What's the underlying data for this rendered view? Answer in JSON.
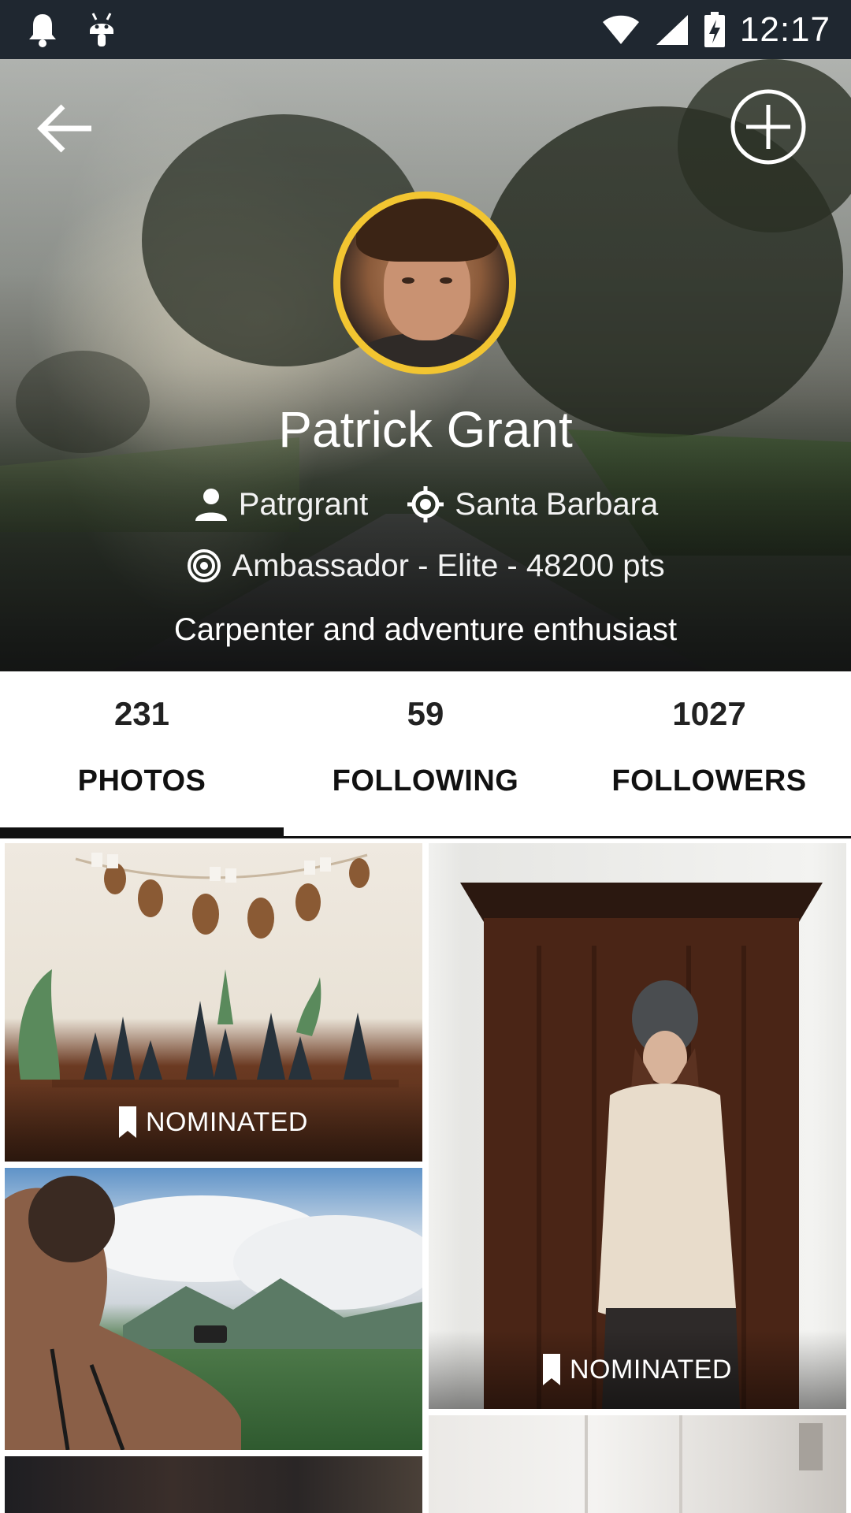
{
  "status_bar": {
    "time": "12:17",
    "icons": [
      "bell-icon",
      "android-icon",
      "wifi-icon",
      "cell-signal-icon",
      "battery-icon"
    ]
  },
  "header": {
    "back_icon": "arrow-back-icon",
    "add_icon": "add-circle-icon"
  },
  "profile": {
    "name": "Patrick Grant",
    "username": "Patrgrant",
    "location": "Santa Barbara",
    "rank": "Ambassador - Elite - 48200 pts",
    "bio": "Carpenter and adventure enthusiast",
    "avatar_ring_color": "#f2c531"
  },
  "tabs": [
    {
      "count": "231",
      "label": "PHOTOS",
      "active": true
    },
    {
      "count": "59",
      "label": "FOLLOWING",
      "active": false
    },
    {
      "count": "1027",
      "label": "FOLLOWERS",
      "active": false
    }
  ],
  "photos": {
    "badge_label": "NOMINATED",
    "badge_icon": "bookmark-icon"
  }
}
